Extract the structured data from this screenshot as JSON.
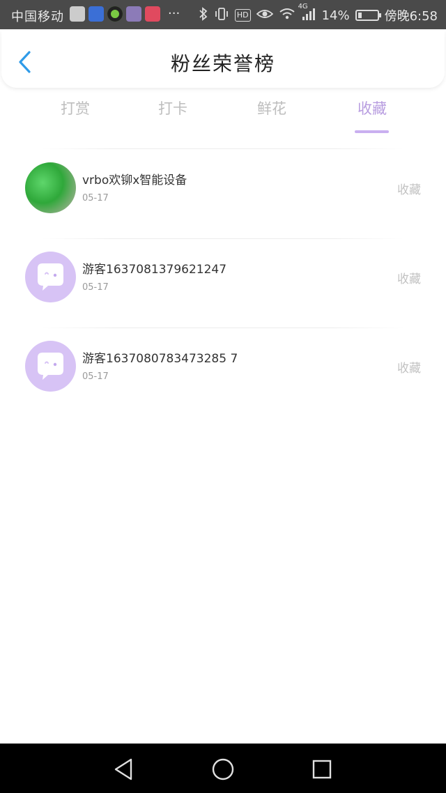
{
  "status_bar": {
    "carrier": "中国移动",
    "battery_percent": "14%",
    "network": "4G",
    "time": "傍晚6:58",
    "hd_label": "HD",
    "more_label": "···"
  },
  "header": {
    "title": "粉丝荣誉榜"
  },
  "tabs": [
    {
      "label": "打赏",
      "active": false
    },
    {
      "label": "打卡",
      "active": false
    },
    {
      "label": "鲜花",
      "active": false
    },
    {
      "label": "收藏",
      "active": true
    }
  ],
  "list": [
    {
      "name": "vrbo欢铆x智能设备",
      "date": "05-17",
      "action": "收藏",
      "avatar": "photo"
    },
    {
      "name": "游客1637081379621247",
      "date": "05-17",
      "action": "收藏",
      "avatar": "chat-bubble-icon"
    },
    {
      "name": "游客1637080783473285 7",
      "date": "05-17",
      "action": "收藏",
      "avatar": "chat-bubble-icon"
    }
  ],
  "colors": {
    "accent": "#b89de0",
    "indicator": "#c9aff0",
    "avatar_bg": "#d7c3f5",
    "back_arrow": "#2f9be8"
  }
}
